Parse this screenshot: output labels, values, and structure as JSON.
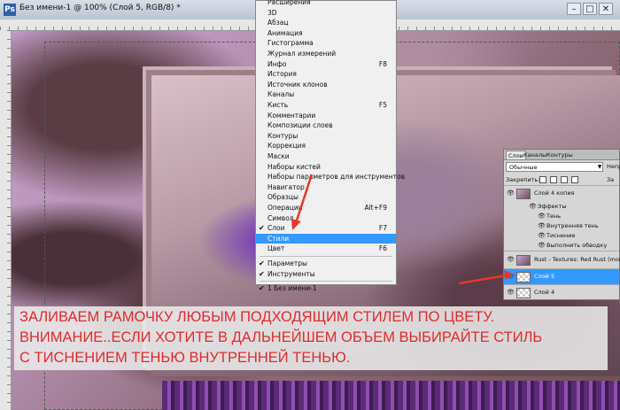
{
  "window": {
    "title": "Без имени-1 @ 100% (Слой 5, RGB/8) *",
    "icon_label": "Ps",
    "minimize_symbol": "–",
    "maximize_symbol": "□",
    "close_symbol": "✕"
  },
  "menu": {
    "items": [
      {
        "label": "Расширения",
        "shortcut": "",
        "checked": false,
        "highlighted": false
      },
      {
        "label": "3D",
        "shortcut": "",
        "checked": false,
        "highlighted": false
      },
      {
        "label": "Абзац",
        "shortcut": "",
        "checked": false,
        "highlighted": false
      },
      {
        "label": "Анимация",
        "shortcut": "",
        "checked": false,
        "highlighted": false
      },
      {
        "label": "Гистограмма",
        "shortcut": "",
        "checked": false,
        "highlighted": false
      },
      {
        "label": "Журнал измерений",
        "shortcut": "",
        "checked": false,
        "highlighted": false
      },
      {
        "label": "Инфо",
        "shortcut": "F8",
        "checked": false,
        "highlighted": false
      },
      {
        "label": "История",
        "shortcut": "",
        "checked": false,
        "highlighted": false
      },
      {
        "label": "Источник клонов",
        "shortcut": "",
        "checked": false,
        "highlighted": false
      },
      {
        "label": "Каналы",
        "shortcut": "",
        "checked": false,
        "highlighted": false
      },
      {
        "label": "Кисть",
        "shortcut": "F5",
        "checked": false,
        "highlighted": false
      },
      {
        "label": "Комментарии",
        "shortcut": "",
        "checked": false,
        "highlighted": false
      },
      {
        "label": "Композиции слоев",
        "shortcut": "",
        "checked": false,
        "highlighted": false
      },
      {
        "label": "Контуры",
        "shortcut": "",
        "checked": false,
        "highlighted": false
      },
      {
        "label": "Коррекция",
        "shortcut": "",
        "checked": false,
        "highlighted": false
      },
      {
        "label": "Маски",
        "shortcut": "",
        "checked": false,
        "highlighted": false
      },
      {
        "label": "Наборы кистей",
        "shortcut": "",
        "checked": false,
        "highlighted": false
      },
      {
        "label": "Наборы параметров для инструментов",
        "shortcut": "",
        "checked": false,
        "highlighted": false
      },
      {
        "label": "Навигатор",
        "shortcut": "",
        "checked": false,
        "highlighted": false
      },
      {
        "label": "Образцы",
        "shortcut": "",
        "checked": false,
        "highlighted": false
      },
      {
        "label": "Операции",
        "shortcut": "Alt+F9",
        "checked": false,
        "highlighted": false
      },
      {
        "label": "Символ",
        "shortcut": "",
        "checked": false,
        "highlighted": false
      },
      {
        "label": "Слои",
        "shortcut": "F7",
        "checked": true,
        "highlighted": false
      },
      {
        "label": "Стили",
        "shortcut": "",
        "checked": false,
        "highlighted": true
      },
      {
        "label": "Цвет",
        "shortcut": "F6",
        "checked": false,
        "highlighted": false
      },
      {
        "label": "Параметры",
        "shortcut": "",
        "checked": true,
        "highlighted": false
      },
      {
        "label": "Инструменты",
        "shortcut": "",
        "checked": true,
        "highlighted": false
      },
      {
        "label": "1 Без имени-1",
        "shortcut": "",
        "checked": true,
        "highlighted": false
      }
    ],
    "check_symbol": "✔"
  },
  "layers_panel": {
    "tabs": [
      "Слои",
      "Каналы",
      "Контуры"
    ],
    "blend_mode": "Обычные",
    "opacity_label": "Непр",
    "lock_label": "Закрепить:",
    "fill_label": "За",
    "eye_symbol": "👁",
    "layers": [
      {
        "name": "Слой 4 копия",
        "selected": false,
        "thumb": "image"
      },
      {
        "name": "Rust - Textures: Red Rust (modified",
        "selected": false,
        "thumb": "image"
      },
      {
        "name": "Слой 5",
        "selected": true,
        "thumb": "check"
      },
      {
        "name": "Слой 4",
        "selected": false,
        "thumb": "check"
      }
    ],
    "effects_label": "Эффекты",
    "effects": [
      "Тень",
      "Внутренняя тень",
      "Тиснение",
      "Выполнить обводку"
    ]
  },
  "caption": {
    "lines": [
      "ЗАЛИВАЕМ РАМОЧКУ ЛЮБЫМ ПОДХОДЯЩИМ СТИЛЕМ ПО ЦВЕТУ.",
      "ВНИМАНИЕ..ЕСЛИ ХОТИТЕ В ДАЛЬНЕЙШЕМ ОБЪЕМ ВЫБИРАЙТЕ СТИЛЬ",
      "С ТИСНЕНИЕМ ТЕНЬЮ ВНУТРЕННЕЙ ТЕНЬЮ."
    ]
  },
  "colors": {
    "highlight": "#3399ff",
    "caption_text": "#e02b2b",
    "annotation_arrow": "#e23a2a"
  }
}
